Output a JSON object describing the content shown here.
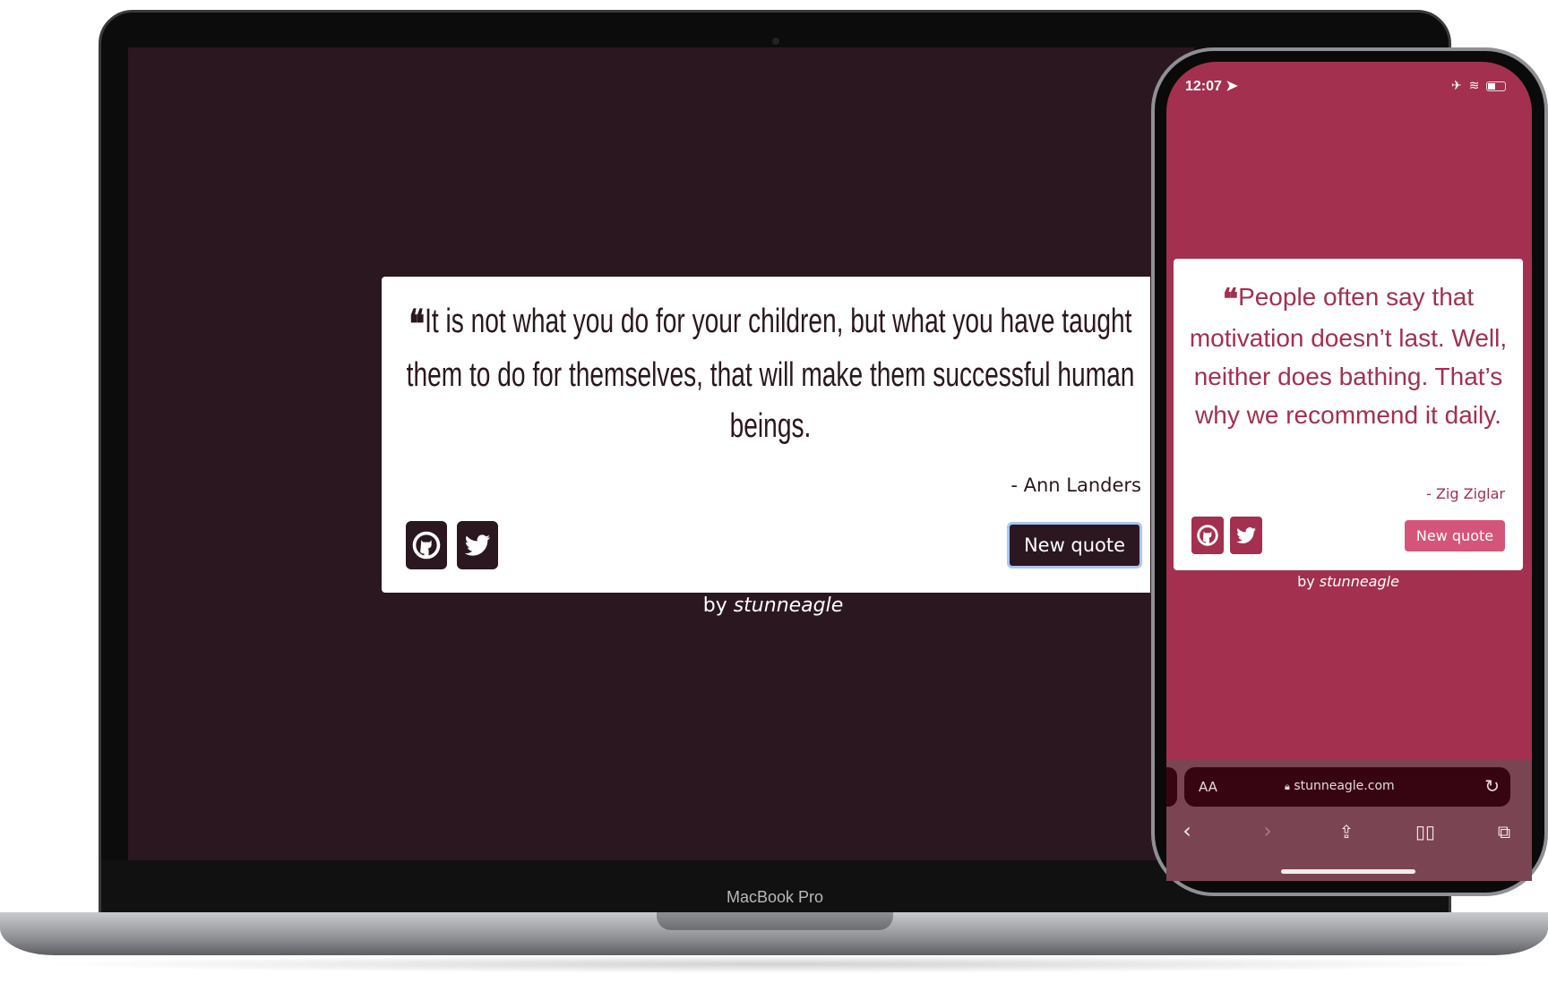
{
  "laptop": {
    "brand_label": "MacBook Pro",
    "background_color": "#2b1720",
    "quote": "It is not what you do for your children, but what you have taught them to do for themselves, that will make them successful human beings.",
    "author": "- Ann Landers",
    "new_quote_label": "New quote",
    "by_prefix": "by",
    "by_name": "stunneagle",
    "icons": [
      "github-icon",
      "twitter-icon"
    ]
  },
  "phone": {
    "status_time": "12:07",
    "background_color": "#a3304f",
    "quote": "People often say that motivation doesn’t last. Well, neither does bathing. That’s why we recommend it daily.",
    "author": "- Zig Ziglar",
    "new_quote_label": "New quote",
    "by_prefix": "by",
    "by_name": "stunneagle",
    "address_bar": {
      "text_size_label": "AA",
      "url": "stunneagle.com"
    }
  }
}
